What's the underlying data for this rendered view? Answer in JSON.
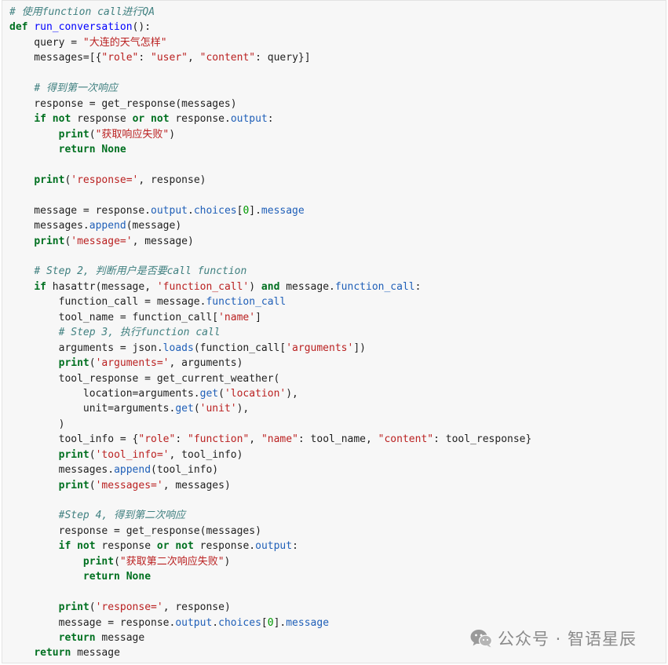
{
  "code": {
    "lines": [
      [
        {
          "t": "# 使用function call进行QA",
          "c": "t-com"
        }
      ],
      [
        {
          "t": "def",
          "c": "t-kw"
        },
        {
          "t": " "
        },
        {
          "t": "run_conversation",
          "c": "t-fn"
        },
        {
          "t": "():"
        }
      ],
      [
        {
          "t": "    query = "
        },
        {
          "t": "\"大连的天气怎样\"",
          "c": "t-str"
        }
      ],
      [
        {
          "t": "    messages=[{"
        },
        {
          "t": "\"role\"",
          "c": "t-str"
        },
        {
          "t": ": "
        },
        {
          "t": "\"user\"",
          "c": "t-str"
        },
        {
          "t": ", "
        },
        {
          "t": "\"content\"",
          "c": "t-str"
        },
        {
          "t": ": query}]"
        }
      ],
      [],
      [
        {
          "t": "    "
        },
        {
          "t": "# 得到第一次响应",
          "c": "t-com"
        }
      ],
      [
        {
          "t": "    response = get_response(messages)"
        }
      ],
      [
        {
          "t": "    "
        },
        {
          "t": "if not",
          "c": "t-kw"
        },
        {
          "t": " response "
        },
        {
          "t": "or not",
          "c": "t-kw"
        },
        {
          "t": " response."
        },
        {
          "t": "output",
          "c": "t-attr"
        },
        {
          "t": ":"
        }
      ],
      [
        {
          "t": "        "
        },
        {
          "t": "print",
          "c": "t-kw"
        },
        {
          "t": "("
        },
        {
          "t": "\"获取响应失败\"",
          "c": "t-str"
        },
        {
          "t": ")"
        }
      ],
      [
        {
          "t": "        "
        },
        {
          "t": "return None",
          "c": "t-kw"
        }
      ],
      [],
      [
        {
          "t": "    "
        },
        {
          "t": "print",
          "c": "t-kw"
        },
        {
          "t": "("
        },
        {
          "t": "'response='",
          "c": "t-str"
        },
        {
          "t": ", response)"
        }
      ],
      [],
      [
        {
          "t": "    message = response."
        },
        {
          "t": "output",
          "c": "t-attr"
        },
        {
          "t": "."
        },
        {
          "t": "choices",
          "c": "t-attr"
        },
        {
          "t": "["
        },
        {
          "t": "0",
          "c": "t-num"
        },
        {
          "t": "]."
        },
        {
          "t": "message",
          "c": "t-attr"
        }
      ],
      [
        {
          "t": "    messages."
        },
        {
          "t": "append",
          "c": "t-attr"
        },
        {
          "t": "(message)"
        }
      ],
      [
        {
          "t": "    "
        },
        {
          "t": "print",
          "c": "t-kw"
        },
        {
          "t": "("
        },
        {
          "t": "'message='",
          "c": "t-str"
        },
        {
          "t": ", message)"
        }
      ],
      [],
      [
        {
          "t": "    "
        },
        {
          "t": "# Step 2, 判断用户是否要call function",
          "c": "t-com"
        }
      ],
      [
        {
          "t": "    "
        },
        {
          "t": "if",
          "c": "t-kw"
        },
        {
          "t": " hasattr(message, "
        },
        {
          "t": "'function_call'",
          "c": "t-str"
        },
        {
          "t": ") "
        },
        {
          "t": "and",
          "c": "t-kw"
        },
        {
          "t": " message."
        },
        {
          "t": "function_call",
          "c": "t-attr"
        },
        {
          "t": ":"
        }
      ],
      [
        {
          "t": "        function_call = message."
        },
        {
          "t": "function_call",
          "c": "t-attr"
        }
      ],
      [
        {
          "t": "        tool_name = function_call["
        },
        {
          "t": "'name'",
          "c": "t-str"
        },
        {
          "t": "]"
        }
      ],
      [
        {
          "t": "        "
        },
        {
          "t": "# Step 3, 执行function call",
          "c": "t-com"
        }
      ],
      [
        {
          "t": "        arguments = json."
        },
        {
          "t": "loads",
          "c": "t-attr"
        },
        {
          "t": "(function_call["
        },
        {
          "t": "'arguments'",
          "c": "t-str"
        },
        {
          "t": "])"
        }
      ],
      [
        {
          "t": "        "
        },
        {
          "t": "print",
          "c": "t-kw"
        },
        {
          "t": "("
        },
        {
          "t": "'arguments='",
          "c": "t-str"
        },
        {
          "t": ", arguments)"
        }
      ],
      [
        {
          "t": "        tool_response = get_current_weather("
        }
      ],
      [
        {
          "t": "            location=arguments."
        },
        {
          "t": "get",
          "c": "t-attr"
        },
        {
          "t": "("
        },
        {
          "t": "'location'",
          "c": "t-str"
        },
        {
          "t": "),"
        }
      ],
      [
        {
          "t": "            unit=arguments."
        },
        {
          "t": "get",
          "c": "t-attr"
        },
        {
          "t": "("
        },
        {
          "t": "'unit'",
          "c": "t-str"
        },
        {
          "t": "),"
        }
      ],
      [
        {
          "t": "        )"
        }
      ],
      [
        {
          "t": "        tool_info = {"
        },
        {
          "t": "\"role\"",
          "c": "t-str"
        },
        {
          "t": ": "
        },
        {
          "t": "\"function\"",
          "c": "t-str"
        },
        {
          "t": ", "
        },
        {
          "t": "\"name\"",
          "c": "t-str"
        },
        {
          "t": ": tool_name, "
        },
        {
          "t": "\"content\"",
          "c": "t-str"
        },
        {
          "t": ": tool_response}"
        }
      ],
      [
        {
          "t": "        "
        },
        {
          "t": "print",
          "c": "t-kw"
        },
        {
          "t": "("
        },
        {
          "t": "'tool_info='",
          "c": "t-str"
        },
        {
          "t": ", tool_info)"
        }
      ],
      [
        {
          "t": "        messages."
        },
        {
          "t": "append",
          "c": "t-attr"
        },
        {
          "t": "(tool_info)"
        }
      ],
      [
        {
          "t": "        "
        },
        {
          "t": "print",
          "c": "t-kw"
        },
        {
          "t": "("
        },
        {
          "t": "'messages='",
          "c": "t-str"
        },
        {
          "t": ", messages)"
        }
      ],
      [],
      [
        {
          "t": "        "
        },
        {
          "t": "#Step 4, 得到第二次响应",
          "c": "t-com"
        }
      ],
      [
        {
          "t": "        response = get_response(messages)"
        }
      ],
      [
        {
          "t": "        "
        },
        {
          "t": "if not",
          "c": "t-kw"
        },
        {
          "t": " response "
        },
        {
          "t": "or not",
          "c": "t-kw"
        },
        {
          "t": " response."
        },
        {
          "t": "output",
          "c": "t-attr"
        },
        {
          "t": ":"
        }
      ],
      [
        {
          "t": "            "
        },
        {
          "t": "print",
          "c": "t-kw"
        },
        {
          "t": "("
        },
        {
          "t": "\"获取第二次响应失败\"",
          "c": "t-str"
        },
        {
          "t": ")"
        }
      ],
      [
        {
          "t": "            "
        },
        {
          "t": "return None",
          "c": "t-kw"
        }
      ],
      [],
      [
        {
          "t": "        "
        },
        {
          "t": "print",
          "c": "t-kw"
        },
        {
          "t": "("
        },
        {
          "t": "'response='",
          "c": "t-str"
        },
        {
          "t": ", response)"
        }
      ],
      [
        {
          "t": "        message = response."
        },
        {
          "t": "output",
          "c": "t-attr"
        },
        {
          "t": "."
        },
        {
          "t": "choices",
          "c": "t-attr"
        },
        {
          "t": "["
        },
        {
          "t": "0",
          "c": "t-num"
        },
        {
          "t": "]."
        },
        {
          "t": "message",
          "c": "t-attr"
        }
      ],
      [
        {
          "t": "        "
        },
        {
          "t": "return",
          "c": "t-kw"
        },
        {
          "t": " message"
        }
      ],
      [
        {
          "t": "    "
        },
        {
          "t": "return",
          "c": "t-kw"
        },
        {
          "t": " message"
        }
      ]
    ]
  },
  "watermark": {
    "text": "公众号 · 智语星辰",
    "icon": "wechat-icon"
  },
  "colors": {
    "background": "#f7f7f7",
    "keyword": "#007020",
    "string": "#ba2121",
    "comment": "#408080",
    "attribute": "#1f5fb8"
  }
}
